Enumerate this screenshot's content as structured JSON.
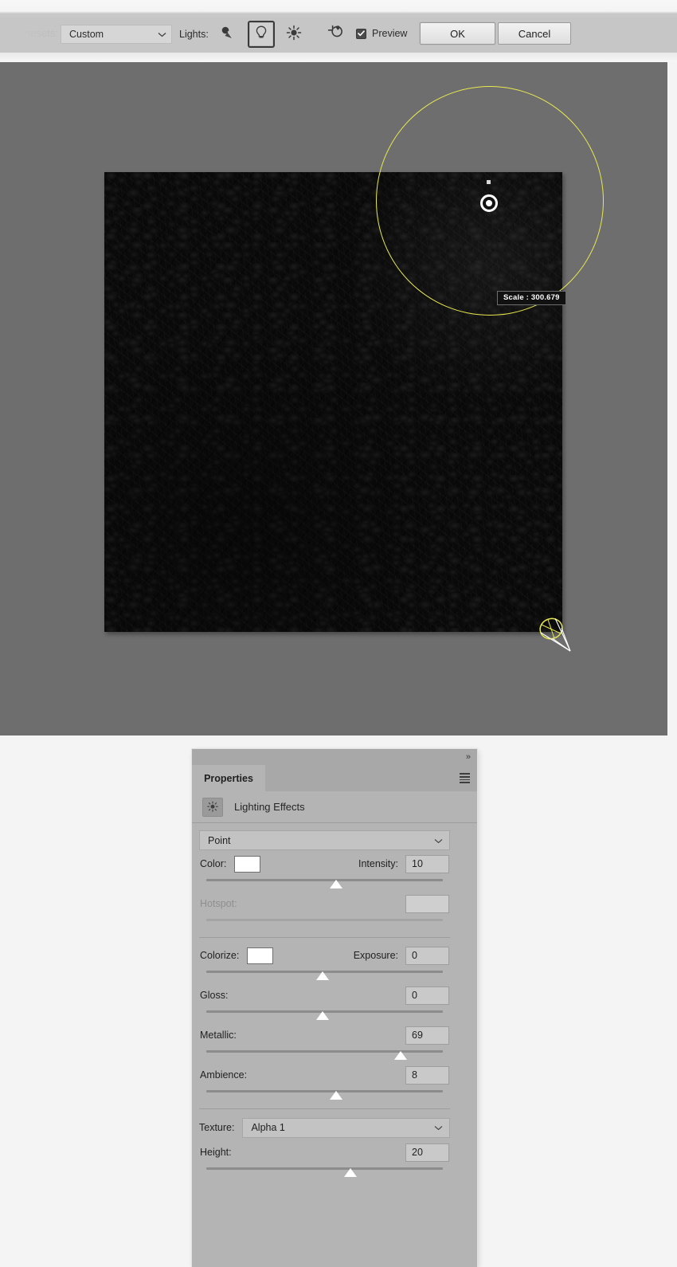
{
  "options_bar": {
    "presets_label": "Presets:",
    "preset_value": "Custom",
    "lights_label": "Lights:",
    "light_buttons": [
      {
        "name": "spot-light",
        "label": "Spot Light",
        "selected": false
      },
      {
        "name": "point-light",
        "label": "Point Light",
        "selected": true
      },
      {
        "name": "infinite-light",
        "label": "Infinite Light",
        "selected": false
      }
    ],
    "reset_label": "Reset Current Light",
    "preview_label": "Preview",
    "preview_checked": true,
    "ok_label": "OK",
    "cancel_label": "Cancel"
  },
  "canvas": {
    "background_color": "#6e6e6e",
    "light_ring_color": "#e8e84f",
    "scale_readout": "Scale : 300.679",
    "document_color": "#0b0b0b"
  },
  "panel": {
    "collapse_icon": "»",
    "tab_label": "Properties",
    "effect_title": "Lighting Effects",
    "light_type": "Point",
    "controls": {
      "color": {
        "label": "Color:",
        "swatch": "#ffffff"
      },
      "intensity": {
        "label": "Intensity:",
        "value": "10",
        "slider_pct": 55
      },
      "hotspot": {
        "label": "Hotspot:",
        "value": "",
        "slider_pct": 0,
        "disabled": true
      },
      "colorize": {
        "label": "Colorize:",
        "swatch": "#ffffff"
      },
      "exposure": {
        "label": "Exposure:",
        "value": "0",
        "slider_pct": 49
      },
      "gloss": {
        "label": "Gloss:",
        "value": "0",
        "slider_pct": 49
      },
      "metallic": {
        "label": "Metallic:",
        "value": "69",
        "slider_pct": 82
      },
      "ambience": {
        "label": "Ambience:",
        "value": "8",
        "slider_pct": 55
      },
      "texture": {
        "label": "Texture:",
        "value": "Alpha 1"
      },
      "height": {
        "label": "Height:",
        "value": "20",
        "slider_pct": 61
      }
    }
  }
}
